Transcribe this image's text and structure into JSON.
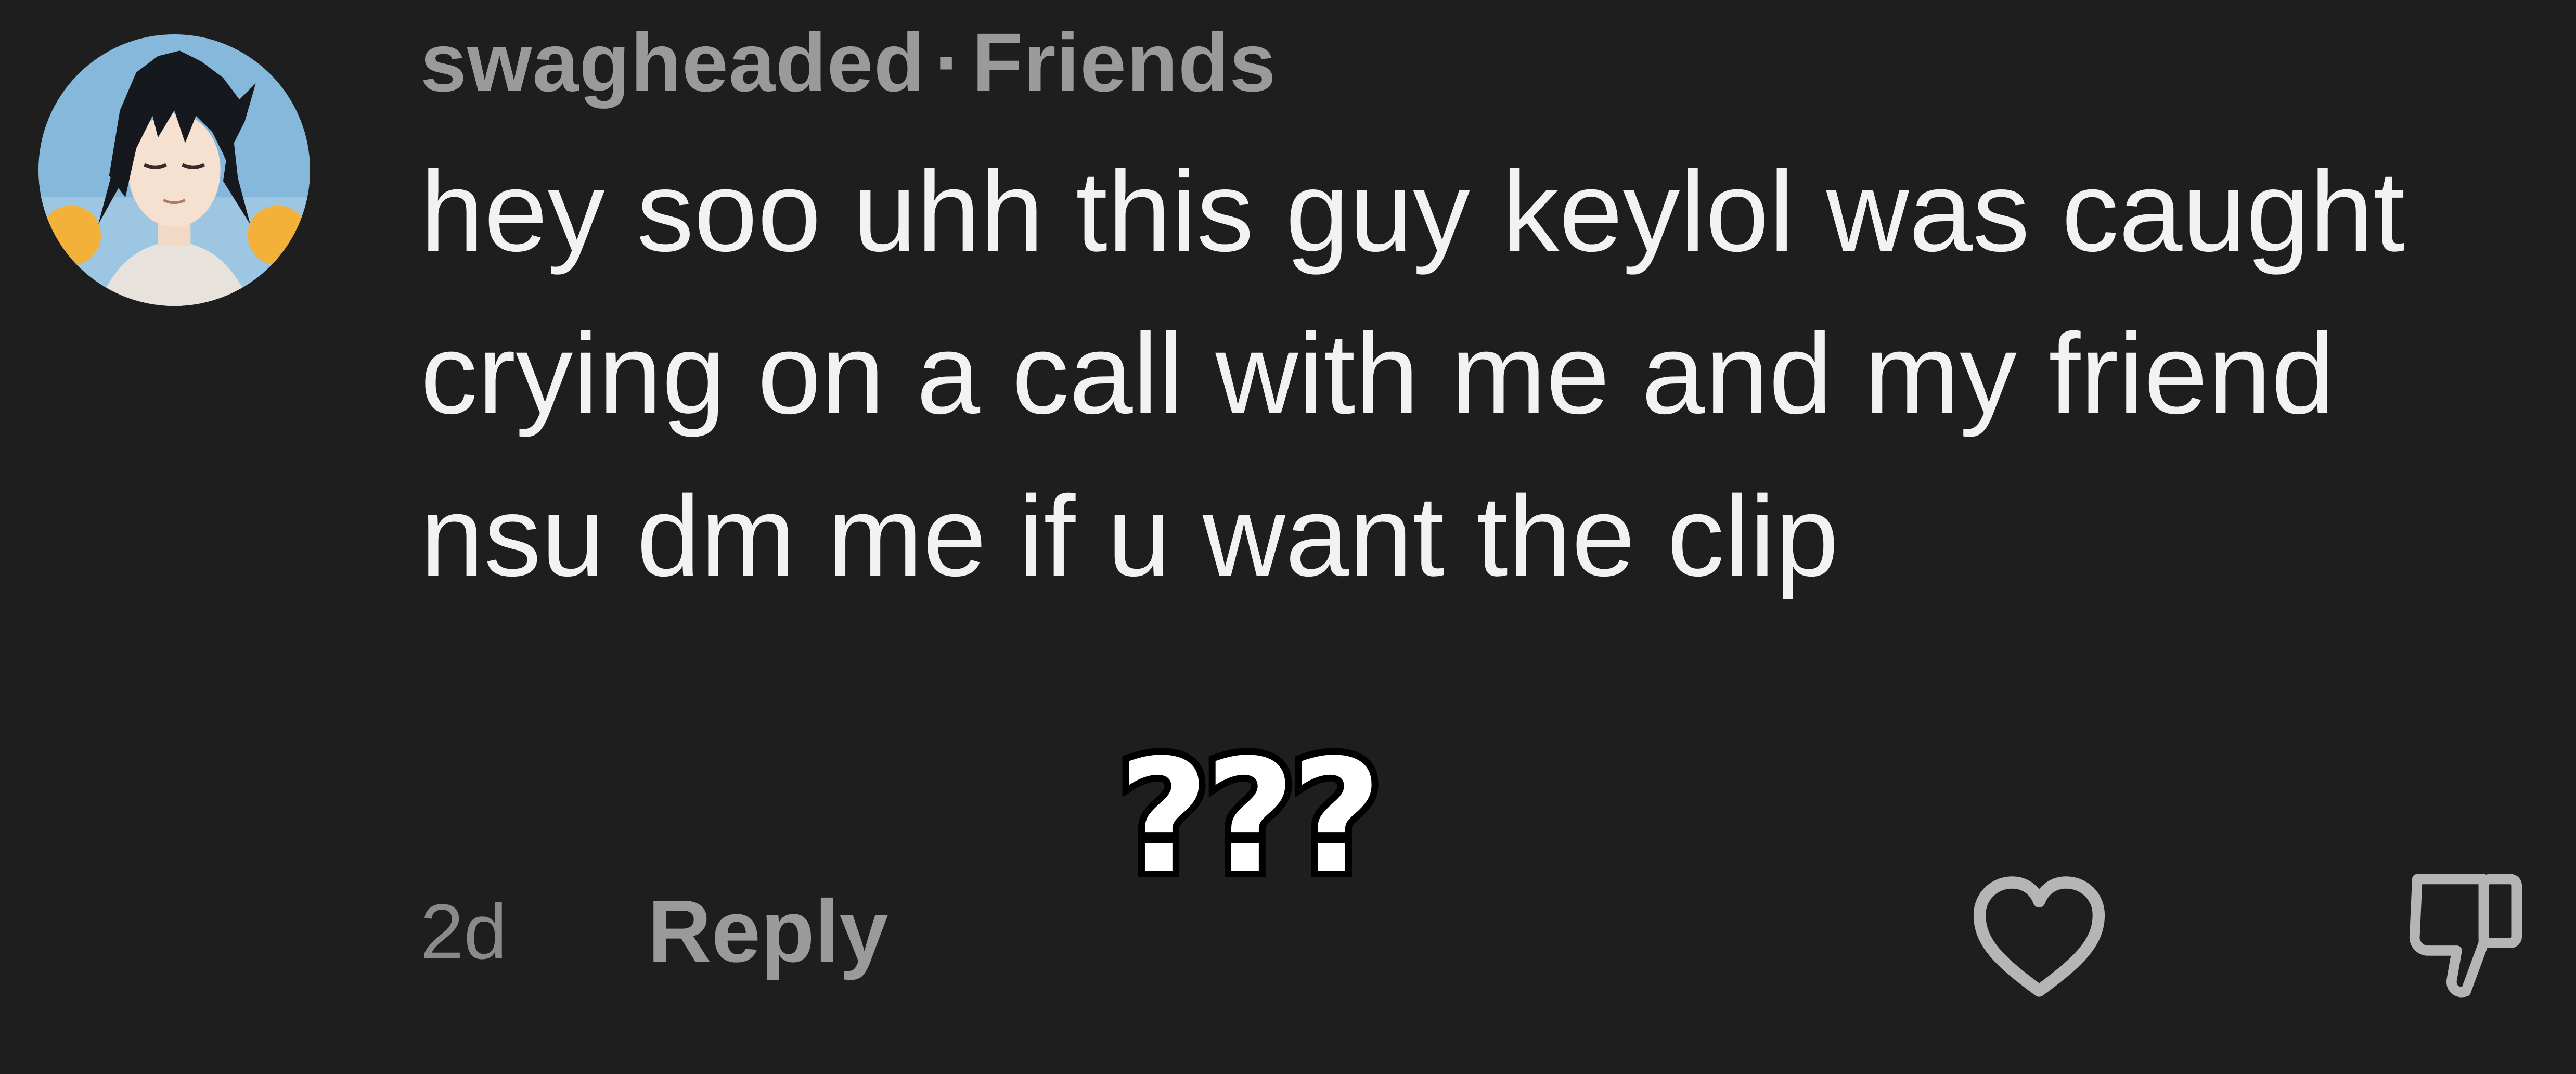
{
  "comment": {
    "username": "swagheaded",
    "separator": "·",
    "relationship": "Friends",
    "body": "hey soo uhh this guy keylol was caught crying on a call with me and my friend nsu dm me if u want the clip",
    "time_ago": "2d",
    "reply_label": "Reply"
  },
  "overlay": {
    "text": "???"
  },
  "icons": {
    "avatar": "anime-avatar",
    "like": "heart-icon",
    "dislike": "thumbs-down-icon"
  },
  "colors": {
    "background": "#1e1e1e",
    "username": "#9a9a9a",
    "body_text": "#f2f2f2",
    "muted": "#8a8a8a",
    "icon": "#b5b5b5"
  }
}
